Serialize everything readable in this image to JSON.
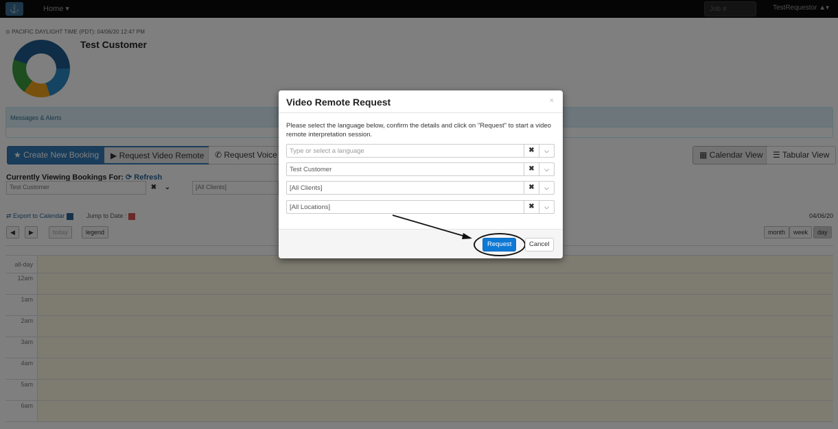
{
  "navbar": {
    "home_label": "Home ▾",
    "job_placeholder": "Job #",
    "user_label": "TestRequestor ▲▾"
  },
  "header": {
    "timezone_label": "⊙ PACIFIC DAYLIGHT TIME (PDT): 04/06/20 12:47 PM",
    "customer_name": "Test Customer"
  },
  "alerts": {
    "title": "Messages & Alerts"
  },
  "actions": {
    "create_booking": "★ Create New Booking",
    "request_video": "▶ Request Video Remote",
    "request_voice": "✆ Request Voice C",
    "calendar_view": "▦ Calendar View",
    "tabular_view": "☰ Tabular View"
  },
  "viewing": {
    "label": "Currently Viewing Bookings For:",
    "refresh": "⟳ Refresh",
    "customer_filter": "Test Customer",
    "client_filter": "[All Clients]"
  },
  "toolbar": {
    "export": "⇄ Export to Calendar",
    "jump": "Jump to Date :",
    "date": "04/06/20",
    "prev": "◀",
    "next": "▶",
    "today": "today",
    "legend": "legend",
    "month": "month",
    "week": "week",
    "day": "day"
  },
  "calendar": {
    "rows": [
      "all-day",
      "12am",
      "1am",
      "2am",
      "3am",
      "4am",
      "5am",
      "6am"
    ]
  },
  "modal": {
    "title": "Video Remote Request",
    "close": "×",
    "description": "Please select the language below, confirm the details and click on \"Request\" to start a video remote interpretation session.",
    "language_placeholder": "Type or select a language",
    "customer_value": "Test Customer",
    "client_value": "[All Clients]",
    "location_value": "[All Locations]",
    "request_label": "Request",
    "cancel_label": "Cancel"
  },
  "colors": {
    "primary": "#337ab7",
    "request": "#0e78d5",
    "calendar_cell": "#fcf8e3"
  }
}
